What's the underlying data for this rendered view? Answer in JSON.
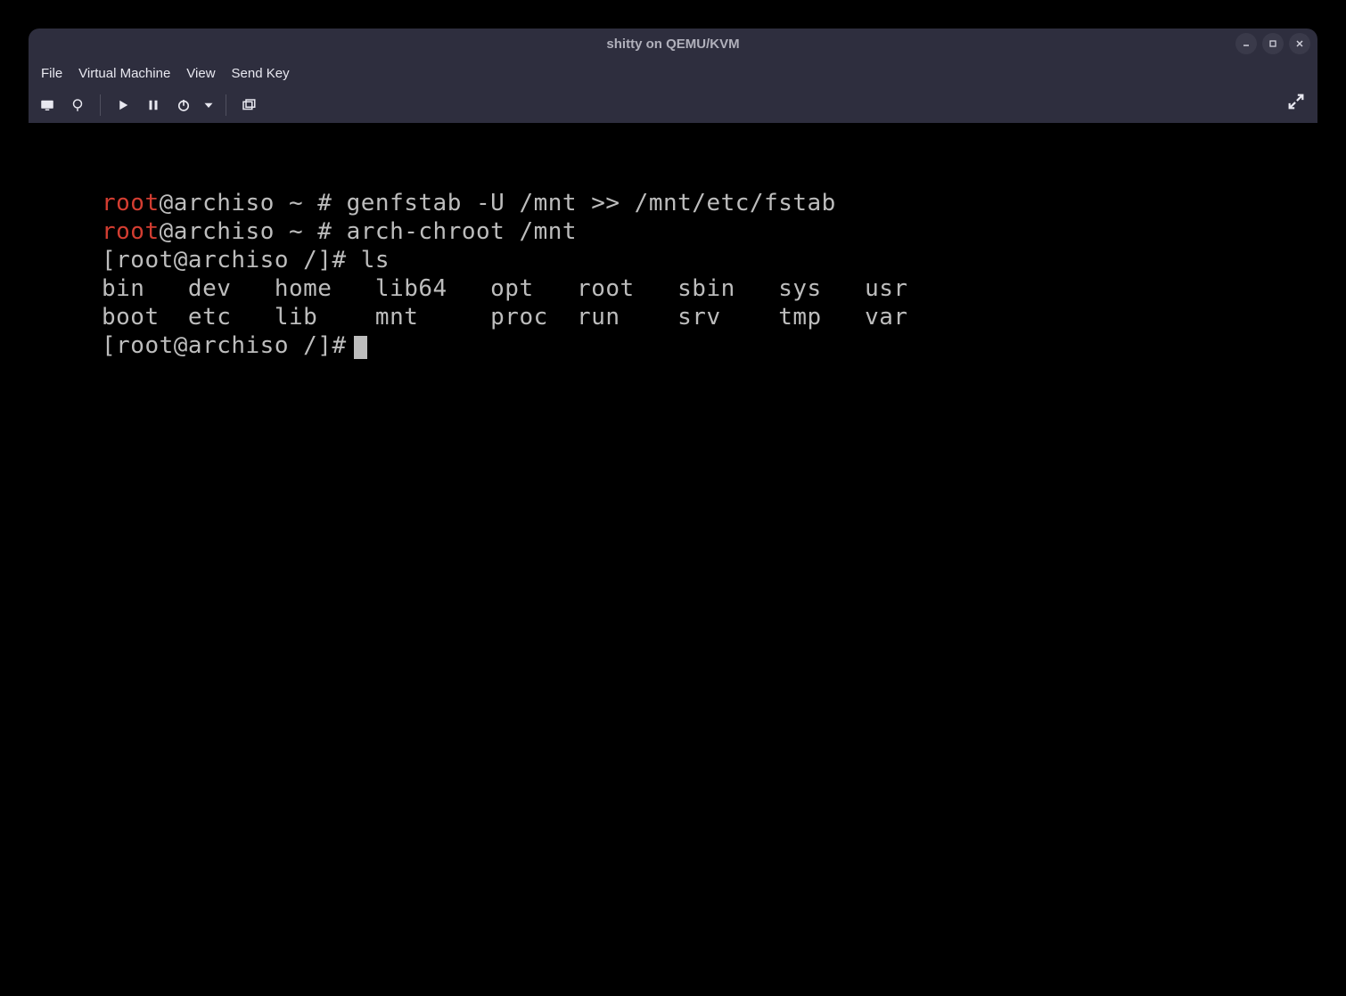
{
  "window": {
    "title": "shitty on QEMU/KVM"
  },
  "menubar": {
    "items": [
      "File",
      "Virtual Machine",
      "View",
      "Send Key"
    ]
  },
  "terminal": {
    "lines": [
      {
        "user": "root",
        "rest": "@archiso ~ # genfstab -U /mnt >> /mnt/etc/fstab"
      },
      {
        "user": "root",
        "rest": "@archiso ~ # arch-chroot /mnt"
      }
    ],
    "chroot_prompt1": "[root@archiso /]# ls",
    "ls_row1": "bin   dev   home   lib64   opt   root   sbin   sys   usr",
    "ls_row2": "boot  etc   lib    mnt     proc  run    srv    tmp   var",
    "chroot_prompt2": "[root@archiso /]#"
  }
}
